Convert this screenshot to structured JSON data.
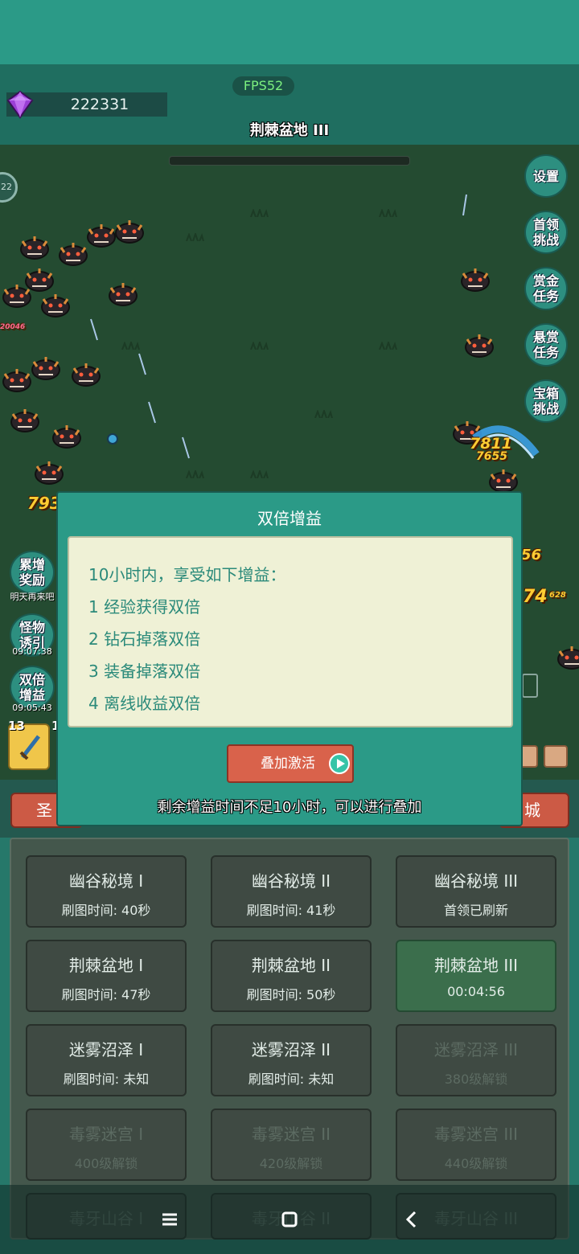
{
  "hud": {
    "gem_count": "222331",
    "fps": "FPS52",
    "stage_title": "荆棘盆地 III",
    "level_badge": "22"
  },
  "side_buttons": [
    {
      "label": "设置",
      "icon": "settings-button"
    },
    {
      "label": "首领\n挑战",
      "icon": "boss-challenge-button"
    },
    {
      "label": "赏金\n任务",
      "icon": "bounty-task-button"
    },
    {
      "label": "悬赏\n任务",
      "icon": "reward-task-button"
    },
    {
      "label": "宝箱\n挑战",
      "icon": "chest-challenge-button"
    }
  ],
  "left_buttons": [
    {
      "label": "累增\n奖励",
      "sub": "明天再来吧"
    },
    {
      "label": "怪物\n诱引",
      "sub": "09:07:38"
    },
    {
      "label": "双倍\n增益",
      "sub": "09:05:43"
    }
  ],
  "damage_numbers": [
    "793",
    "7811",
    "7655",
    "56",
    "74",
    "20046",
    "628"
  ],
  "equip": {
    "slot_level": "13",
    "next_level": "1"
  },
  "tabs": {
    "left": "圣",
    "right": "城"
  },
  "dialog": {
    "title": "双倍增益",
    "lines": [
      "10小时内，享受如下增益：",
      "1 经验获得双倍",
      "2 钻石掉落双倍",
      "3 装备掉落双倍",
      "4 离线收益双倍"
    ],
    "activate_label": "叠加激活",
    "note": "剩余增益时间不足10小时，可以进行叠加"
  },
  "stages": [
    {
      "name": "幽谷秘境 I",
      "sub": "刷图时间: 40秒",
      "state": "normal"
    },
    {
      "name": "幽谷秘境 II",
      "sub": "刷图时间: 41秒",
      "state": "normal"
    },
    {
      "name": "幽谷秘境 III",
      "sub": "首领已刷新",
      "state": "normal"
    },
    {
      "name": "荆棘盆地 I",
      "sub": "刷图时间: 47秒",
      "state": "normal"
    },
    {
      "name": "荆棘盆地 II",
      "sub": "刷图时间: 50秒",
      "state": "normal"
    },
    {
      "name": "荆棘盆地 III",
      "sub": "00:04:56",
      "state": "active"
    },
    {
      "name": "迷雾沼泽 I",
      "sub": "刷图时间: 未知",
      "state": "normal"
    },
    {
      "name": "迷雾沼泽 II",
      "sub": "刷图时间: 未知",
      "state": "normal"
    },
    {
      "name": "迷雾沼泽 III",
      "sub": "380级解锁",
      "state": "locked"
    },
    {
      "name": "毒雾迷宫 I",
      "sub": "400级解锁",
      "state": "locked"
    },
    {
      "name": "毒雾迷宫 II",
      "sub": "420级解锁",
      "state": "locked"
    },
    {
      "name": "毒雾迷宫 III",
      "sub": "440级解锁",
      "state": "locked"
    },
    {
      "name": "毒牙山谷 I",
      "sub": "",
      "state": "locked"
    },
    {
      "name": "毒牙山谷 II",
      "sub": "",
      "state": "locked"
    },
    {
      "name": "毒牙山谷 III",
      "sub": "",
      "state": "locked"
    }
  ],
  "colors": {
    "accent": "#2b9a87",
    "button_red": "#d9624b",
    "dialog_body": "#eff1d6",
    "dialog_text": "#2b8a7a",
    "fps_green": "#7cf07f"
  }
}
